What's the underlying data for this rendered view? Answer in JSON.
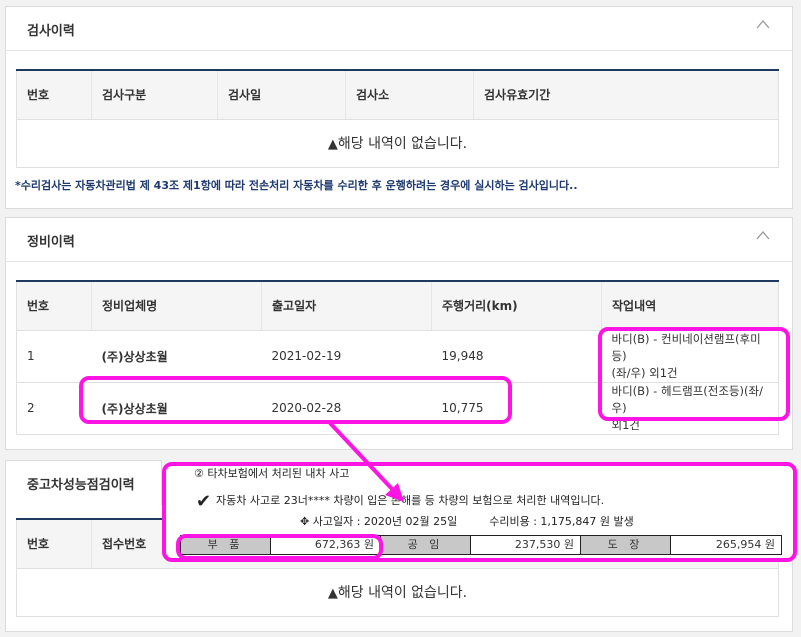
{
  "inspection": {
    "title": "검사이력",
    "headers": [
      "번호",
      "검사구분",
      "검사일",
      "검사소",
      "검사유효기간"
    ],
    "empty_text": "해당 내역이 없습니다.",
    "note": "*수리검사는 자동차관리법 제 43조 제1항에 따라 전손처리 자동차를 수리한 후 운행하려는 경우에 실시하는 검사입니다.."
  },
  "maintenance": {
    "title": "정비이력",
    "headers": [
      "번호",
      "정비업체명",
      "출고일자",
      "주행거리(km)",
      "작업내역"
    ],
    "rows": [
      {
        "no": "1",
        "company": "(주)상상초월",
        "date": "2021-02-19",
        "mileage": "19,948",
        "work_line1": "바디(B) - 컨비네이션램프(후미등)",
        "work_line2": "(좌/우) 외1건"
      },
      {
        "no": "2",
        "company": "(주)상상초월",
        "date": "2020-02-28",
        "mileage": "10,775",
        "work_line1": "바디(B) - 헤드램프(전조등)(좌/우)",
        "work_line2": "외1건"
      }
    ]
  },
  "performance": {
    "tab_label": "중고차성능점검이력",
    "headers": [
      "번호",
      "접수번호"
    ],
    "empty_text": "해당 내역이 없습니다."
  },
  "insurance": {
    "line1": "② 타차보험에서 처리된 내차 사고",
    "line2": "자동차 사고로 23너**** 차량이 입은 손해를 등 차량의 보험으로 처리한 내역입니다.",
    "line3_date": "사고일자 : 2020년 02월 25일",
    "line3_cost": "수리비용 : 1,175,847 원 발생",
    "costs": [
      {
        "label": "부 품",
        "value": "672,363 원"
      },
      {
        "label": "공 임",
        "value": "237,530 원"
      },
      {
        "label": "도 장",
        "value": "265,954 원"
      }
    ]
  },
  "colors": {
    "highlight": "#ff14e4",
    "header_border": "#1e3a60",
    "note": "#1e3a70"
  }
}
